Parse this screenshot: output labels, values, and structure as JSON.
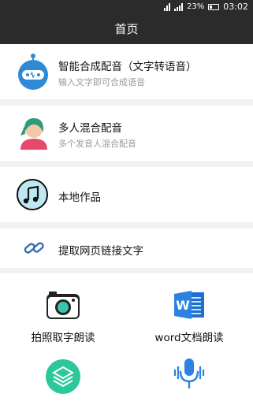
{
  "status": {
    "battery": "23%",
    "time": "03:02"
  },
  "header": {
    "title": "首页"
  },
  "menu": [
    {
      "title": "智能合成配音（文字转语音）",
      "subtitle": "输入文字即可合成语音"
    },
    {
      "title": "多人混合配音",
      "subtitle": "多个发音人混合配音"
    },
    {
      "title": "本地作品"
    },
    {
      "title": "提取网页链接文字"
    }
  ],
  "grid": [
    {
      "label": "拍照取字朗读",
      "icon": "camera-icon"
    },
    {
      "label": "word文档朗读",
      "icon": "word-icon"
    },
    {
      "label": "",
      "icon": "layers-icon"
    },
    {
      "label": "",
      "icon": "microphone-icon"
    }
  ]
}
